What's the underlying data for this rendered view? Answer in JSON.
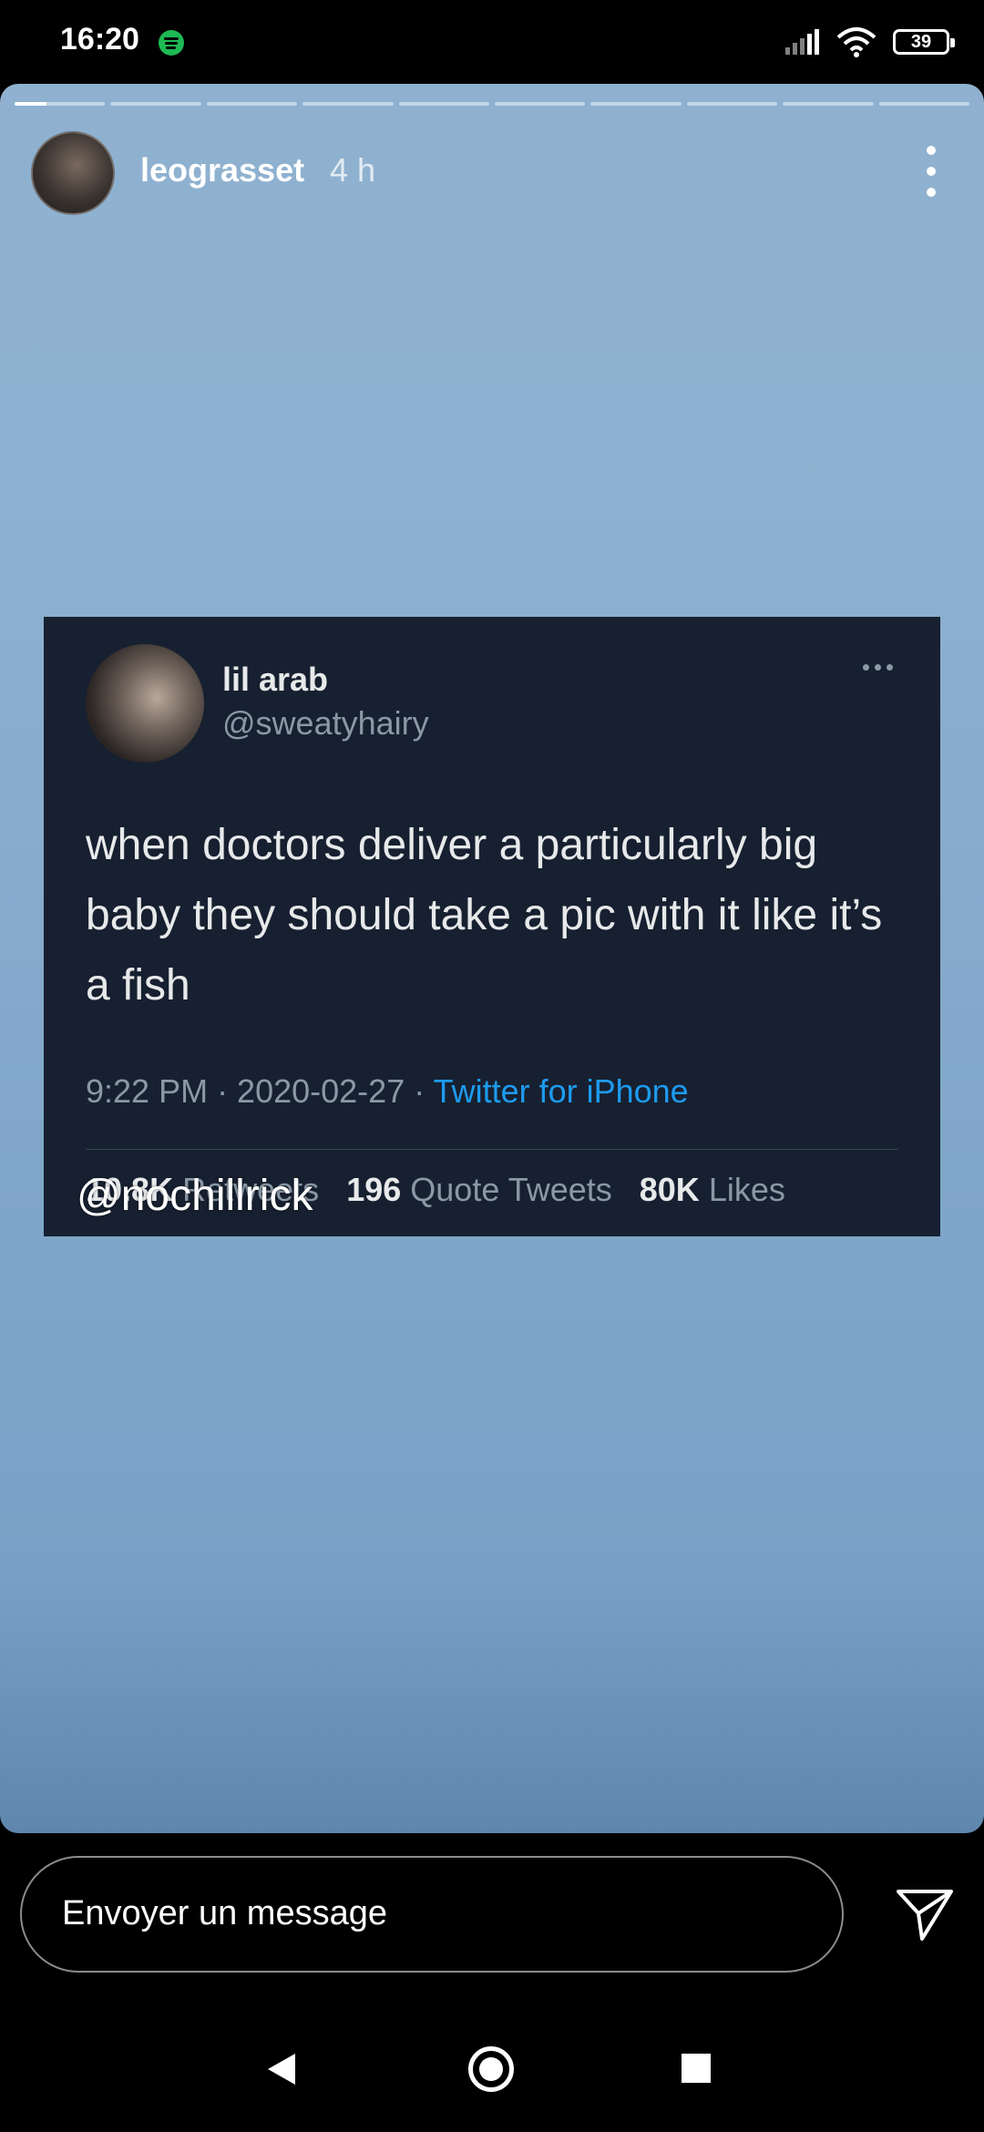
{
  "status_bar": {
    "time": "16:20",
    "battery": "39",
    "icons": [
      "spotify-icon",
      "signal-icon",
      "wifi-icon",
      "battery-icon"
    ]
  },
  "story": {
    "username": "leograsset",
    "time_ago": "4 h",
    "segments_total": 10,
    "active_segment_progress": 0.35,
    "mention": "@nochillrick"
  },
  "tweet": {
    "name": "lil arab",
    "handle": "@sweatyhairy",
    "text": "when doctors deliver a particularly big baby they should take a pic with it like it’s a fish",
    "time": "9:22 PM · 2020-02-27 · ",
    "source": "Twitter for iPhone",
    "stats": {
      "retweets_count": "10.8K",
      "retweets_label": "Retweets",
      "quotes_count": "196",
      "quotes_label": "Quote Tweets",
      "likes_count": "80K",
      "likes_label": "Likes"
    }
  },
  "reply": {
    "placeholder": "Envoyer un message"
  },
  "colors": {
    "story_top": "#8fb1cf",
    "story_bottom": "#5f86ad",
    "tweet_bg": "#172030",
    "link_blue": "#1d9bf0",
    "spotify_green": "#1db954"
  }
}
